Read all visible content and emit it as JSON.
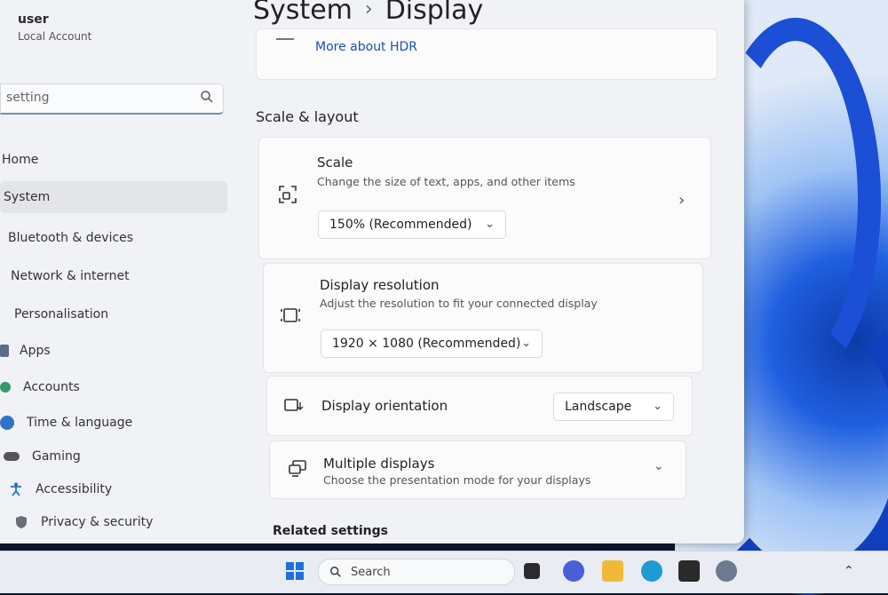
{
  "user": {
    "name": "user",
    "account_type": "Local Account"
  },
  "search": {
    "value": "setting",
    "icon": "search-icon"
  },
  "nav": {
    "items": [
      {
        "label": "Home",
        "icon": "home-icon"
      },
      {
        "label": "System",
        "icon": "system-icon",
        "active": true
      },
      {
        "label": "Bluetooth & devices",
        "icon": "bluetooth-icon"
      },
      {
        "label": "Network & internet",
        "icon": "network-icon"
      },
      {
        "label": "Personalisation",
        "icon": "brush-icon"
      },
      {
        "label": "Apps",
        "icon": "apps-icon"
      },
      {
        "label": "Accounts",
        "icon": "accounts-icon"
      },
      {
        "label": "Time & language",
        "icon": "globe-icon"
      },
      {
        "label": "Gaming",
        "icon": "gamepad-icon"
      },
      {
        "label": "Accessibility",
        "icon": "accessibility-icon"
      },
      {
        "label": "Privacy & security",
        "icon": "shield-icon"
      }
    ]
  },
  "breadcrumb": {
    "parent": "System",
    "separator": "›",
    "current": "Display"
  },
  "hdr": {
    "link": "More about HDR"
  },
  "section": {
    "title": "Scale & layout"
  },
  "scale": {
    "title": "Scale",
    "subtitle": "Change the size of text, apps, and other items",
    "value": "150% (Recommended)"
  },
  "resolution": {
    "title": "Display resolution",
    "subtitle": "Adjust the resolution to fit your connected display",
    "value": "1920 × 1080 (Recommended)"
  },
  "orientation": {
    "title": "Display orientation",
    "value": "Landscape"
  },
  "multiple": {
    "title": "Multiple displays",
    "subtitle": "Choose the presentation mode for your displays"
  },
  "related": {
    "title": "Related settings"
  },
  "taskbar": {
    "search_placeholder": "Search",
    "icons": [
      "start-icon",
      "search-icon",
      "task-view-icon",
      "chat-icon",
      "file-explorer-icon",
      "edge-icon",
      "store-icon",
      "settings-icon"
    ]
  },
  "colors": {
    "accent": "#1f4fb0",
    "window_bg": "#f0f2f5",
    "card_bg": "#fbfbfc"
  }
}
